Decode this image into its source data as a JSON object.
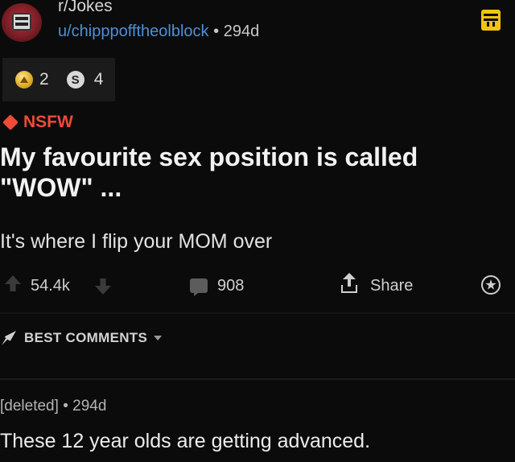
{
  "post": {
    "subreddit": "r/Jokes",
    "username": "u/chipppofftheolblock",
    "separator": "•",
    "age": "294d",
    "awards": [
      {
        "icon": "gold-award-icon",
        "count": "2"
      },
      {
        "icon": "silver-award-icon",
        "count": "4",
        "glyph": "S"
      }
    ],
    "nsfw_label": "NSFW",
    "title": "My favourite sex position is called \"WOW\" ...",
    "body": "It's where I flip your MOM over",
    "score": "54.4k",
    "comment_count": "908",
    "share_label": "Share"
  },
  "comments_section": {
    "sort_label": "BEST COMMENTS"
  },
  "comment": {
    "author": "[deleted]",
    "separator": "•",
    "age": "294d",
    "text": "These 12 year olds are getting advanced."
  },
  "colors": {
    "background": "#0b0b0b",
    "username_link": "#4f8fd8",
    "nsfw": "#f04a3a",
    "menu_icon": "#f1c40f"
  }
}
